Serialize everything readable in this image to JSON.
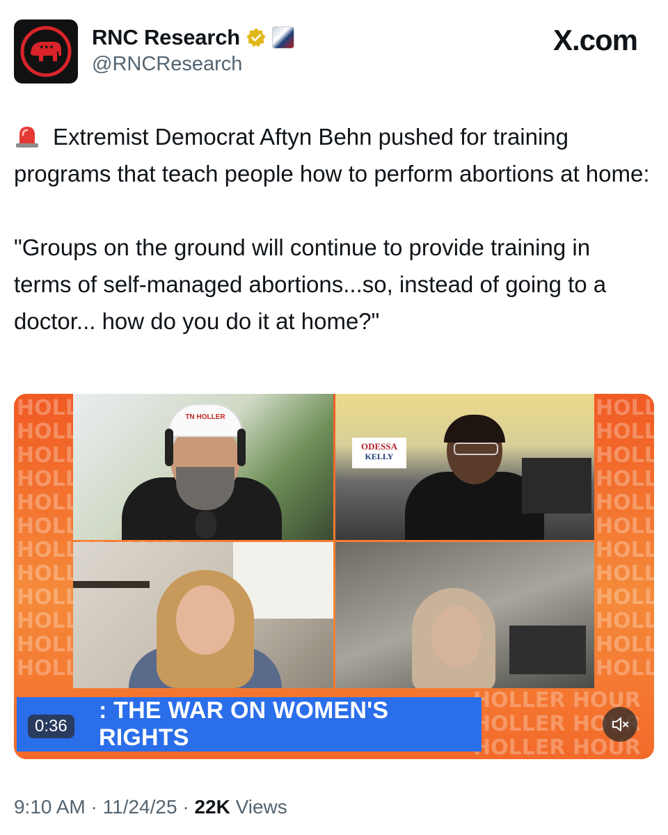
{
  "header": {
    "display_name": "RNC Research",
    "handle": "@RNCResearch",
    "site_logo": "X.com",
    "verified_badge_icon": "verified-gold-badge-icon",
    "affiliate_badge_icon": "affiliate-photo-badge-icon",
    "avatar_icon": "elephant-logo-icon"
  },
  "tweet": {
    "emoji_icon": "police-siren-icon",
    "paragraph_1": "Extremist Democrat Aftyn Behn pushed for training programs that teach people how to perform abortions at home:",
    "paragraph_2": "\"Groups on the ground will continue to provide training in terms of self-managed abortions...so, instead of going to a doctor... how do you do it at home?\""
  },
  "video": {
    "banner_text": ": THE WAR ON WOMEN'S RIGHTS",
    "duration": "0:36",
    "mute_icon": "speaker-muted-icon",
    "hat_text": "TN HOLLER",
    "sign_line_1": "ODESSA",
    "sign_line_2": "KELLY",
    "watermark_text": "HOLLER HOUR"
  },
  "footer": {
    "time": "9:10 AM",
    "date": "11/24/25",
    "views_count": "22K",
    "views_label": "Views",
    "separator": "·"
  },
  "colors": {
    "brand_orange": "#f05a23",
    "banner_blue": "#2b6ee9",
    "verified_gold": "#e2b719",
    "rnc_red": "#d8242a",
    "muted_text": "#536471"
  }
}
